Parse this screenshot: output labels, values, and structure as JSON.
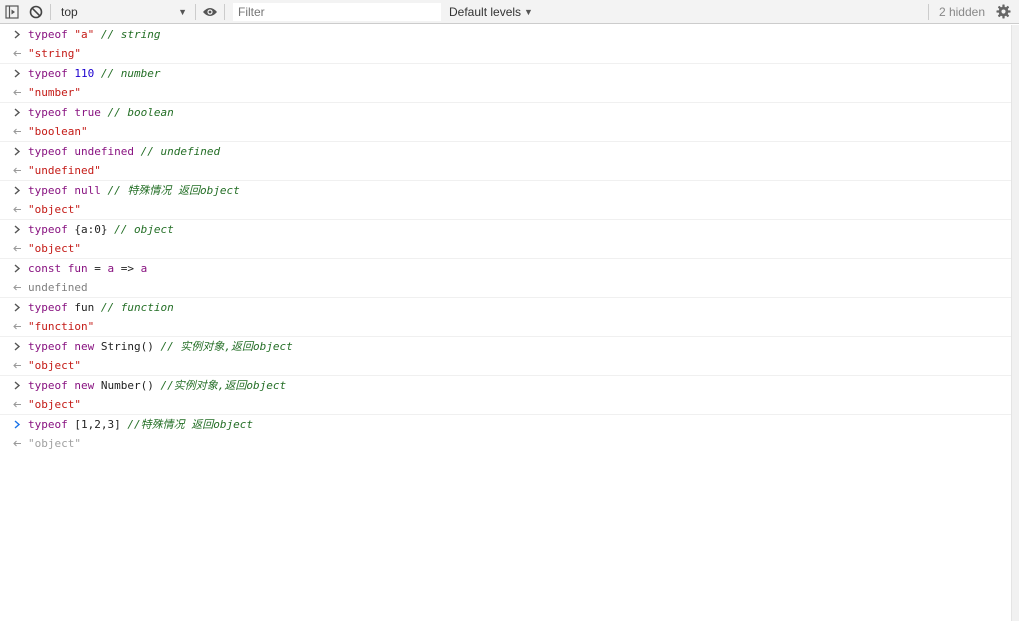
{
  "toolbar": {
    "context": "top",
    "filter_placeholder": "Filter",
    "levels_label": "Default levels",
    "hidden_label": "2 hidden"
  },
  "icons": {
    "sidebar": "sidebar-toggle-icon",
    "clear": "clear-console-icon",
    "eye": "live-expression-eye-icon",
    "settings": "gear-icon",
    "input_prompt": "chevron-right-icon",
    "result": "return-arrow-icon"
  },
  "colors": {
    "keyword": "#881280",
    "string": "#c41a16",
    "number": "#1c00cf",
    "comment": "#236e25",
    "prompt_active": "#1a73e8"
  },
  "entries": [
    {
      "input": [
        [
          "kw",
          "typeof "
        ],
        [
          "str",
          "\"a\""
        ],
        [
          "cm",
          " // string"
        ]
      ],
      "output": [
        [
          "str",
          "\"string\""
        ]
      ]
    },
    {
      "input": [
        [
          "kw",
          "typeof "
        ],
        [
          "num",
          "110"
        ],
        [
          "cm",
          " // number"
        ]
      ],
      "output": [
        [
          "str",
          "\"number\""
        ]
      ]
    },
    {
      "input": [
        [
          "kw",
          "typeof "
        ],
        [
          "kw",
          "true"
        ],
        [
          "cm",
          " // boolean"
        ]
      ],
      "output": [
        [
          "str",
          "\"boolean\""
        ]
      ]
    },
    {
      "input": [
        [
          "kw",
          "typeof "
        ],
        [
          "kw",
          "undefined"
        ],
        [
          "cm",
          " // undefined"
        ]
      ],
      "output": [
        [
          "str",
          "\"undefined\""
        ]
      ]
    },
    {
      "input": [
        [
          "kw",
          "typeof "
        ],
        [
          "kw",
          "null"
        ],
        [
          "cm",
          " // 特殊情况 返回object"
        ]
      ],
      "output": [
        [
          "str",
          "\"object\""
        ]
      ]
    },
    {
      "input": [
        [
          "kw",
          "typeof "
        ],
        [
          "ident",
          "{a:0}"
        ],
        [
          "cm",
          " // object"
        ]
      ],
      "output": [
        [
          "str",
          "\"object\""
        ]
      ]
    },
    {
      "input": [
        [
          "kw",
          "const "
        ],
        [
          "kw",
          "fun"
        ],
        [
          "op",
          " = "
        ],
        [
          "kw",
          "a"
        ],
        [
          "op",
          " => "
        ],
        [
          "kw",
          "a"
        ]
      ],
      "output": [
        [
          "undef",
          "undefined"
        ]
      ]
    },
    {
      "input": [
        [
          "kw",
          "typeof "
        ],
        [
          "ident",
          "fun"
        ],
        [
          "cm",
          " // function"
        ]
      ],
      "output": [
        [
          "str",
          "\"function\""
        ]
      ]
    },
    {
      "input": [
        [
          "kw",
          "typeof "
        ],
        [
          "kw",
          "new "
        ],
        [
          "ident",
          "String()"
        ],
        [
          "cm",
          " // 实例对象,返回object"
        ]
      ],
      "output": [
        [
          "str",
          "\"object\""
        ]
      ]
    },
    {
      "input": [
        [
          "kw",
          "typeof "
        ],
        [
          "kw",
          "new "
        ],
        [
          "ident",
          "Number()"
        ],
        [
          "cm",
          " //实例对象,返回object"
        ]
      ],
      "output": [
        [
          "str",
          "\"object\""
        ]
      ]
    },
    {
      "input": [
        [
          "kw",
          "typeof "
        ],
        [
          "ident",
          "[1,2,3]"
        ],
        [
          "cm",
          " //特殊情况 返回object"
        ]
      ],
      "output": [
        [
          "faded",
          "\"object\""
        ]
      ],
      "active": true
    }
  ]
}
